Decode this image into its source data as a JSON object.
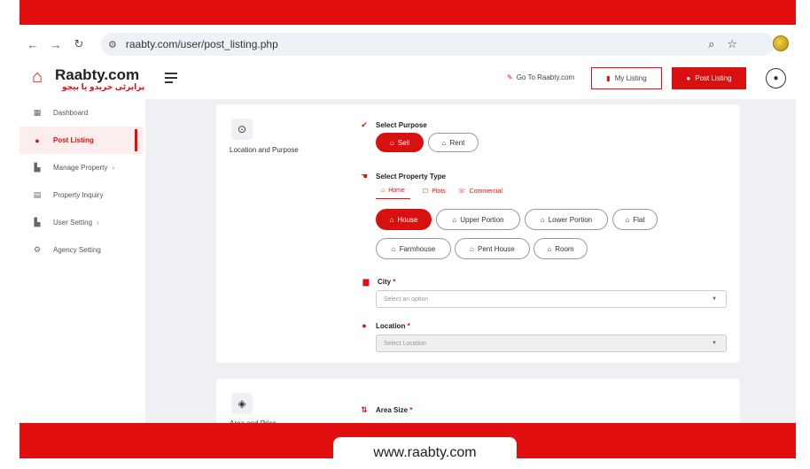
{
  "browser": {
    "url": "raabty.com/user/post_listing.php"
  },
  "header": {
    "brand_name": "Raabty.com",
    "brand_tagline": "پراپرٹی خریدو یا بیچو",
    "goto_label": "Go To Raabty.com",
    "my_listing_label": "My Listing",
    "post_listing_label": "Post Listing"
  },
  "sidebar": {
    "items": [
      {
        "label": "Dashboard",
        "icon": "dashboard-icon"
      },
      {
        "label": "Post Listing",
        "icon": "location-pin-icon",
        "active": true
      },
      {
        "label": "Manage Property",
        "icon": "building-icon",
        "has_submenu": true
      },
      {
        "label": "Property Inquiry",
        "icon": "inbox-icon"
      },
      {
        "label": "User Setting",
        "icon": "building-icon",
        "has_submenu": true
      },
      {
        "label": "Agency Setting",
        "icon": "gear-icon"
      }
    ]
  },
  "form": {
    "section1_title": "Location and Purpose",
    "purpose_label": "Select Purpose",
    "purpose_options": [
      "Sell",
      "Rent"
    ],
    "purpose_selected": "Sell",
    "type_label": "Select Property Type",
    "type_tabs": [
      "Home",
      "Plots",
      "Commercial"
    ],
    "type_tab_selected": "Home",
    "home_types": [
      "House",
      "Upper Portion",
      "Lower Portion",
      "Flat",
      "Farmhouse",
      "Pent House",
      "Room"
    ],
    "home_type_selected": "House",
    "city_label": "City",
    "city_placeholder": "Select an option",
    "location_label": "Location",
    "location_placeholder": "Select Location",
    "required_mark": "*",
    "section2_title": "Area and Price",
    "area_label": "Area Size"
  },
  "footer": {
    "site": "www.raabty.com"
  },
  "colors": {
    "brand_red": "#e10f0f",
    "content_bg": "#eff0f3"
  }
}
